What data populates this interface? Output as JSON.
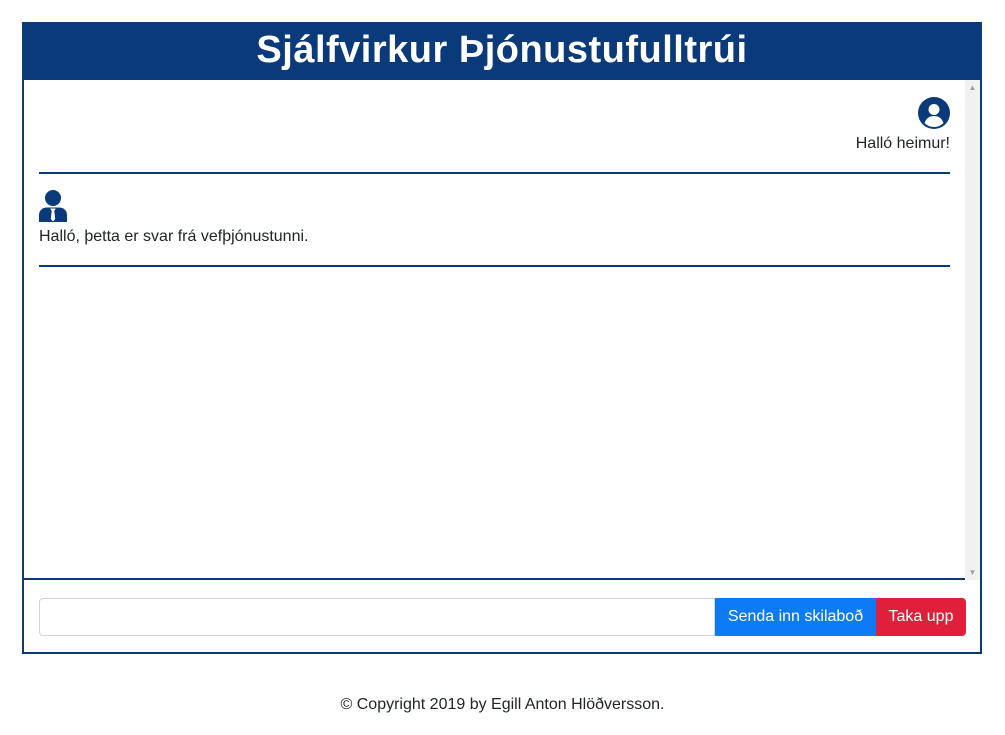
{
  "header": {
    "title": "Sjálfvirkur Þjónustufulltrúi"
  },
  "messages": [
    {
      "sender": "user",
      "icon": "user-circle-icon",
      "text": "Halló heimur!"
    },
    {
      "sender": "bot",
      "icon": "user-tie-icon",
      "text": "Halló, þetta er svar frá vefþjónustunni."
    }
  ],
  "input": {
    "value": "",
    "placeholder": ""
  },
  "buttons": {
    "send_label": "Senda inn skilaboð",
    "record_label": "Taka upp"
  },
  "footer": {
    "copyright": "© Copyright 2019 by Egill Anton Hlöðversson."
  },
  "colors": {
    "primary": "#0a3a7a",
    "send": "#0d7bf5",
    "record": "#e0203b"
  }
}
